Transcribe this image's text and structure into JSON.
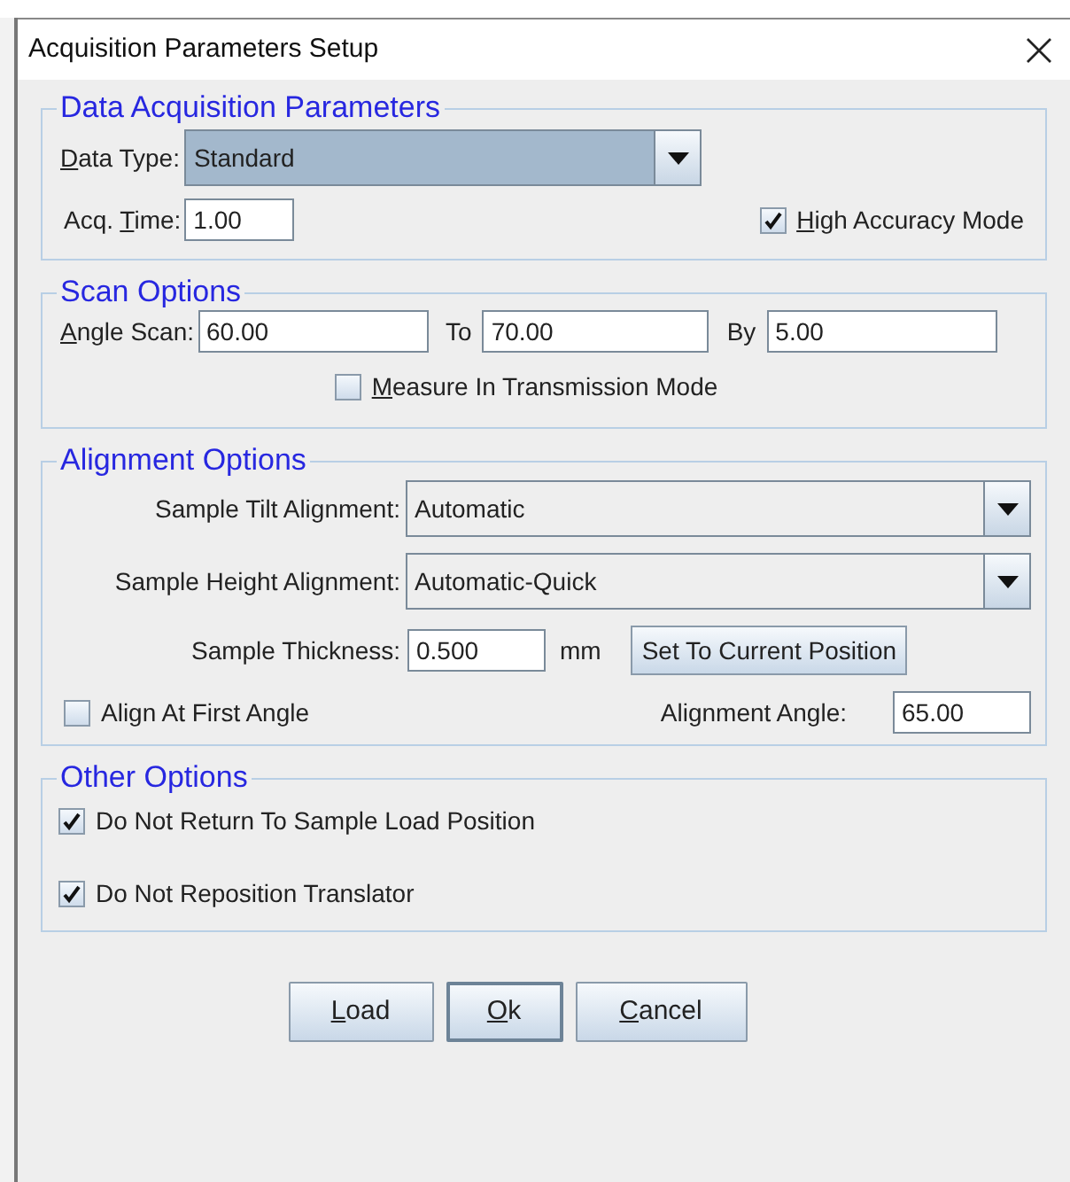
{
  "window": {
    "title": "Acquisition Parameters Setup"
  },
  "data_acquisition": {
    "title": "Data Acquisition Parameters",
    "data_type": {
      "label": {
        "key": "D",
        "after": "ata Type:"
      },
      "value": "Standard",
      "focused": true
    },
    "acq_time": {
      "label": {
        "before": "Acq. ",
        "key": "T",
        "after": "ime:"
      },
      "value": "1.00"
    },
    "high_accuracy": {
      "label": {
        "key": "H",
        "after": "igh Accuracy Mode"
      },
      "checked": true
    }
  },
  "scan_options": {
    "title": "Scan Options",
    "angle_scan": {
      "label": {
        "key": "A",
        "after": "ngle Scan:"
      },
      "value": "60.00"
    },
    "to": {
      "label": "To",
      "value": "70.00"
    },
    "by": {
      "label": "By",
      "value": "5.00"
    },
    "transmission": {
      "label": {
        "key": "M",
        "after": "easure In Transmission Mode"
      },
      "checked": false
    }
  },
  "alignment_options": {
    "title": "Alignment Options",
    "tilt": {
      "label": "Sample Tilt Alignment:",
      "value": "Automatic"
    },
    "height": {
      "label": "Sample Height Alignment:",
      "value": "Automatic-Quick"
    },
    "thickness": {
      "label": "Sample Thickness:",
      "value": "0.500",
      "unit": "mm",
      "button": "Set To Current Position"
    },
    "align_first": {
      "label": "Align At First Angle",
      "checked": false
    },
    "alignment_angle": {
      "label": "Alignment Angle:",
      "value": "65.00"
    }
  },
  "other_options": {
    "title": "Other Options",
    "items": [
      {
        "label": "Do Not Return To Sample Load Position",
        "checked": true
      },
      {
        "label": "Do Not Reposition Translator",
        "checked": true
      }
    ]
  },
  "buttons": [
    {
      "label": {
        "key": "L",
        "after": "oad"
      },
      "default": false
    },
    {
      "label": {
        "key": "O",
        "after": "k"
      },
      "default": true
    },
    {
      "label": {
        "key": "C",
        "after": "ancel"
      },
      "default": false
    }
  ]
}
